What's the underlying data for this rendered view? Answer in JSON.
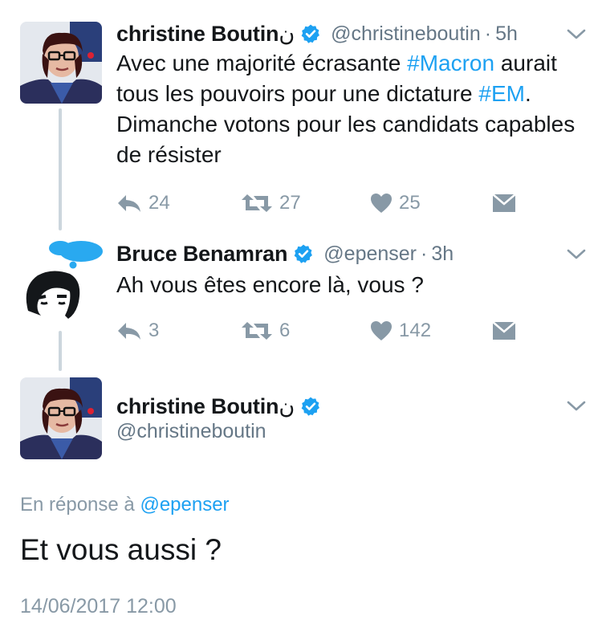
{
  "tweet1": {
    "name": "christine Boutin",
    "name_suffix": "ن",
    "handle": "@christineboutin",
    "separator": "·",
    "time": "5h",
    "text_parts": {
      "p1": "Avec une majorité écrasante ",
      "tag1": "#Macron",
      "p2": " aurait tous les pouvoirs pour une dictature ",
      "tag2": "#EM",
      "p3": ". Dimanche votons pour les candidats capables de résister"
    },
    "replies": "24",
    "retweets": "27",
    "likes": "25"
  },
  "tweet2": {
    "name": "Bruce Benamran",
    "handle": "@epenser",
    "separator": "·",
    "time": "3h",
    "text": "Ah vous êtes encore là, vous ?",
    "replies": "3",
    "retweets": "6",
    "likes": "142"
  },
  "main_tweet": {
    "name": "christine Boutin",
    "name_suffix": "ن",
    "handle": "@christineboutin",
    "reply_prefix": "En réponse à",
    "reply_mention": "@epenser",
    "text": "Et vous aussi ?",
    "timestamp": "14/06/2017 12:00"
  },
  "colors": {
    "accent": "#1da1f2",
    "muted": "#8899a6",
    "verified": "#1da1f2"
  },
  "icons": [
    "reply-icon",
    "retweet-icon",
    "heart-icon",
    "message-icon",
    "chevron-down-icon",
    "verified-badge-icon"
  ]
}
